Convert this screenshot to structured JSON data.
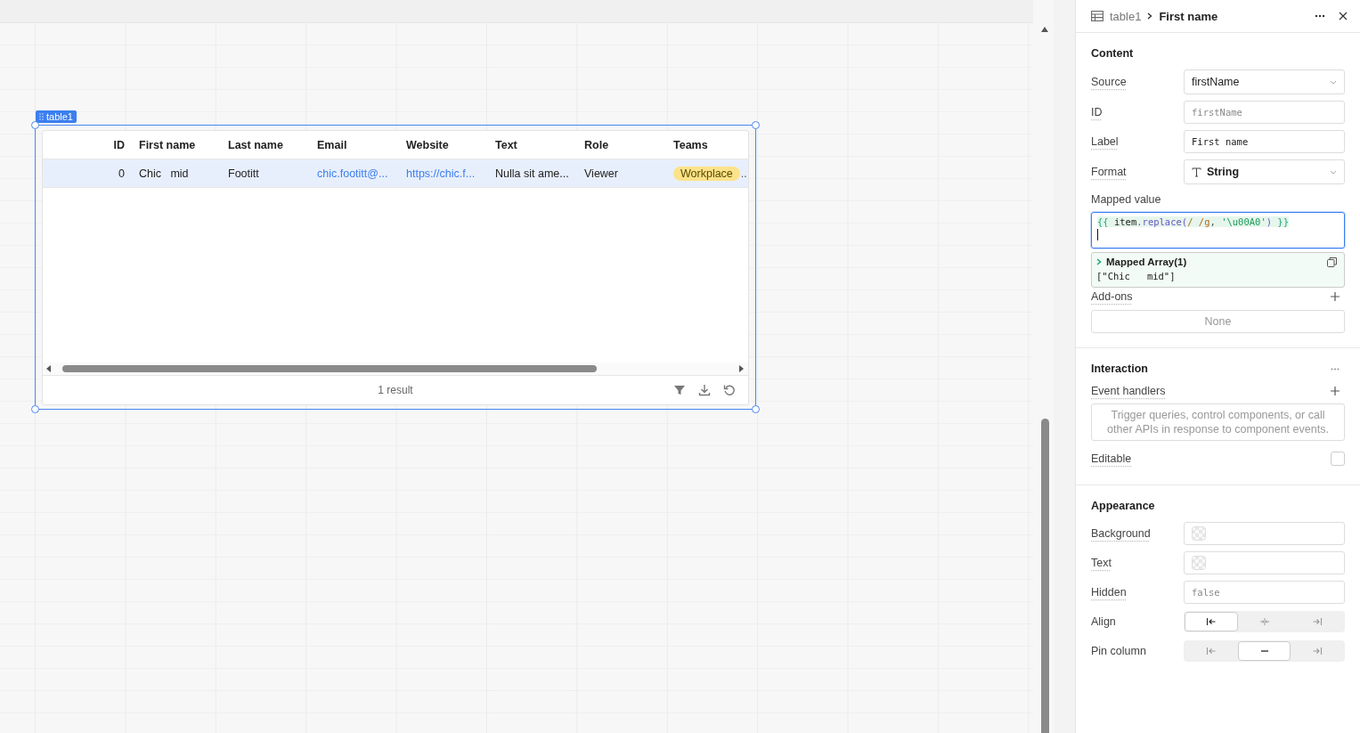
{
  "canvas": {
    "component": {
      "label": "table1",
      "columns": [
        {
          "label": "ID"
        },
        {
          "label": "First name"
        },
        {
          "label": "Last name"
        },
        {
          "label": "Email"
        },
        {
          "label": "Website"
        },
        {
          "label": "Text"
        },
        {
          "label": "Role"
        },
        {
          "label": "Teams"
        }
      ],
      "rows": [
        {
          "selected": true,
          "cells": [
            {
              "kind": "text",
              "text": "0"
            },
            {
              "kind": "text",
              "text": "Chic   mid"
            },
            {
              "kind": "text",
              "text": "Footitt"
            },
            {
              "kind": "link",
              "text": "chic.footitt@..."
            },
            {
              "kind": "link",
              "text": "https://chic.f..."
            },
            {
              "kind": "text",
              "text": "Nulla sit ame..."
            },
            {
              "kind": "text",
              "text": "Viewer"
            },
            {
              "kind": "tag",
              "text": "Workplace",
              "color": "#fce38a",
              "overflow": ".."
            }
          ]
        }
      ],
      "footer": {
        "count": "1 result"
      }
    }
  },
  "inspector": {
    "breadcrumb": {
      "parent": "table1",
      "current": "First name"
    },
    "content": {
      "title": "Content",
      "fields": [
        {
          "label": "Source",
          "kind": "select",
          "value": "firstName"
        },
        {
          "label": "ID",
          "kind": "code",
          "placeholder": "firstName"
        },
        {
          "label": "Label",
          "kind": "code",
          "value": "First name"
        },
        {
          "label": "Format",
          "kind": "type-select",
          "value": "String"
        }
      ],
      "mapped_value": {
        "label": "Mapped value",
        "tokens": [
          {
            "kind": "brace",
            "text": "{{ "
          },
          {
            "kind": "ident",
            "text": "item"
          },
          {
            "kind": "method",
            "text": ".replace("
          },
          {
            "kind": "regex",
            "text": "/ /g"
          },
          {
            "kind": "punct",
            "text": ", "
          },
          {
            "kind": "string",
            "text": "'\\u00A0'"
          },
          {
            "kind": "method",
            "text": ")"
          },
          {
            "kind": "brace",
            "text": " }}"
          }
        ],
        "preview": {
          "title": "Mapped Array(1)",
          "result": "[\"Chic   mid\"]"
        }
      },
      "addons": {
        "label": "Add-ons",
        "empty": "None"
      }
    },
    "interaction": {
      "title": "Interaction",
      "event_handlers": {
        "label": "Event handlers",
        "empty": "Trigger queries, control components, or call other APIs in response to component events."
      },
      "editable": {
        "label": "Editable",
        "checked": false
      }
    },
    "appearance": {
      "title": "Appearance",
      "fields": [
        {
          "label": "Background",
          "kind": "color"
        },
        {
          "label": "Text",
          "kind": "color"
        },
        {
          "label": "Hidden",
          "kind": "code",
          "placeholder": "false"
        },
        {
          "label": "Align",
          "kind": "align",
          "options": [
            {
              "selected": true
            },
            {
              "selected": false
            },
            {
              "selected": false
            }
          ]
        },
        {
          "label": "Pin column",
          "kind": "pin",
          "options": [
            {
              "selected": false
            },
            {
              "selected": true
            },
            {
              "selected": false
            }
          ]
        }
      ]
    }
  }
}
